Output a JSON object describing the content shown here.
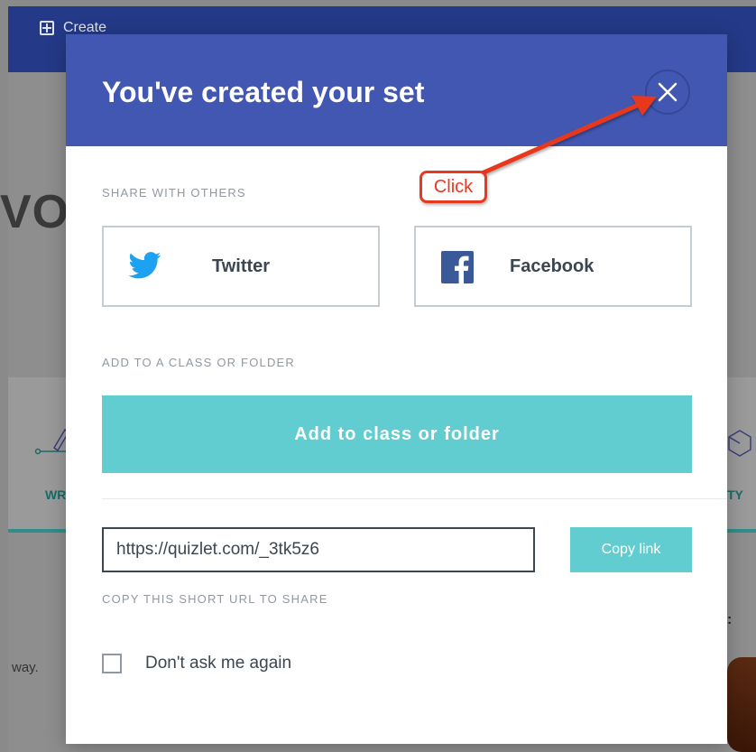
{
  "background": {
    "create_label": "Create",
    "heading_fragment": "VOI",
    "left_mode_fragment": "WR",
    "right_mode_fragment": "TY",
    "body_fragment": "way.",
    "colon_fragment": ":"
  },
  "modal": {
    "title": "You've created your set",
    "share_section_label": "SHARE WITH OTHERS",
    "twitter_label": "Twitter",
    "facebook_label": "Facebook",
    "add_section_label": "ADD TO A CLASS OR FOLDER",
    "add_button_label": "Add to class or folder",
    "share_url": "https://quizlet.com/_3tk5z6",
    "copy_button_label": "Copy link",
    "url_hint": "COPY THIS SHORT URL TO SHARE",
    "dont_ask_label": "Don't ask me again"
  },
  "annotation": {
    "callout_text": "Click",
    "color": "#e8391f"
  },
  "colors": {
    "header": "#4257b2",
    "accent_teal": "#62cdd0",
    "twitter_blue": "#1da1f2",
    "facebook_blue": "#3b5998"
  }
}
